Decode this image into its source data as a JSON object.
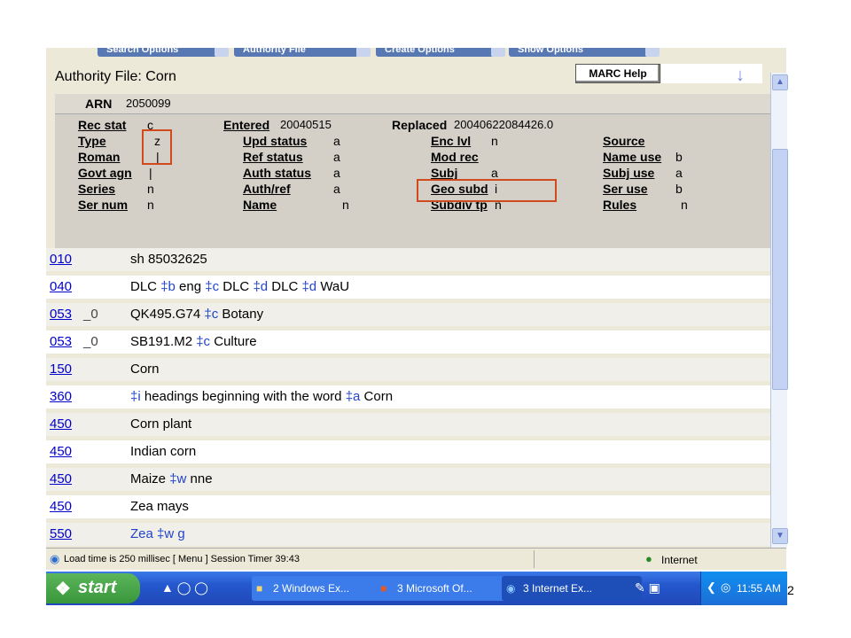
{
  "tabs": [
    "Search Options",
    "Authority File",
    "Create Options",
    "Show Options"
  ],
  "window": {
    "title": "Authority File: Corn",
    "marc_help": "MARC Help"
  },
  "fixed": {
    "arn_label": "ARN",
    "arn_value": "2050099",
    "rec_stat_label": "Rec stat",
    "rec_stat_value": "c",
    "entered_label": "Entered",
    "entered_value": "20040515",
    "replaced_label": "Replaced",
    "replaced_value": "20040622084426.0",
    "type_label": "Type",
    "type_value": "z",
    "upd_status_label": "Upd status",
    "upd_status_value": "a",
    "enc_lvl_label": "Enc lvl",
    "enc_lvl_value": "n",
    "source_label": "Source",
    "source_value": "",
    "roman_label": "Roman",
    "roman_value": "|",
    "ref_status_label": "Ref status",
    "ref_status_value": "a",
    "mod_rec_label": "Mod rec",
    "mod_rec_value": "",
    "name_use_label": "Name use",
    "name_use_value": "b",
    "govt_agn_label": "Govt agn",
    "govt_agn_value": "|",
    "auth_status_label": "Auth status",
    "auth_status_value": "a",
    "subj_label": "Subj",
    "subj_value": "a",
    "subj_use_label": "Subj use",
    "subj_use_value": "a",
    "series_label": "Series",
    "series_value": "n",
    "auth_ref_label": "Auth/ref",
    "auth_ref_value": "a",
    "geo_subd_label": "Geo subd",
    "geo_subd_value": "i",
    "ser_use_label": "Ser use",
    "ser_use_value": "b",
    "ser_num_label": "Ser num",
    "ser_num_value": "n",
    "name_label": "Name",
    "name_value": "n",
    "subdiv_tp_label": "Subdiv tp",
    "subdiv_tp_value": "n",
    "rules_label": "Rules",
    "rules_value": "n"
  },
  "rows": [
    {
      "tag": "010",
      "ind": "",
      "parts": [
        {
          "t": "sh 85032625"
        }
      ]
    },
    {
      "tag": "040",
      "ind": "",
      "parts": [
        {
          "t": "DLC "
        },
        {
          "t": "‡b",
          "sf": true
        },
        {
          "t": " eng "
        },
        {
          "t": "‡c",
          "sf": true
        },
        {
          "t": " DLC "
        },
        {
          "t": "‡d",
          "sf": true
        },
        {
          "t": " DLC "
        },
        {
          "t": "‡d",
          "sf": true
        },
        {
          "t": " WaU"
        }
      ]
    },
    {
      "tag": "053",
      "ind": "_0",
      "parts": [
        {
          "t": "QK495.G74 "
        },
        {
          "t": "‡c",
          "sf": true
        },
        {
          "t": " Botany"
        }
      ]
    },
    {
      "tag": "053",
      "ind": "_0",
      "parts": [
        {
          "t": "SB191.M2 "
        },
        {
          "t": "‡c",
          "sf": true
        },
        {
          "t": " Culture"
        }
      ]
    },
    {
      "tag": "150",
      "ind": "",
      "parts": [
        {
          "t": "Corn"
        }
      ]
    },
    {
      "tag": "360",
      "ind": "",
      "parts": [
        {
          "t": "‡i",
          "sf": true
        },
        {
          "t": " headings beginning with the word "
        },
        {
          "t": "‡a",
          "sf": true
        },
        {
          "t": " Corn"
        }
      ]
    },
    {
      "tag": "450",
      "ind": "",
      "parts": [
        {
          "t": "Corn plant"
        }
      ]
    },
    {
      "tag": "450",
      "ind": "",
      "parts": [
        {
          "t": "Indian corn"
        }
      ]
    },
    {
      "tag": "450",
      "ind": "",
      "parts": [
        {
          "t": "Maize "
        },
        {
          "t": "‡w",
          "sf": true
        },
        {
          "t": " nne"
        }
      ]
    },
    {
      "tag": "450",
      "ind": "",
      "parts": [
        {
          "t": "Zea mays"
        }
      ]
    },
    {
      "tag": "550",
      "ind": "",
      "parts": [
        {
          "t": "Zea ‡w g",
          "lnk": true
        }
      ]
    }
  ],
  "status": {
    "text": "Load time is 250 millisec [ Menu ]   Session Timer 39:43",
    "zone": "Internet"
  },
  "taskbar": {
    "start": "start",
    "tasks": [
      "2 Windows Ex...",
      "3 Microsoft Of...",
      "3 Internet Ex..."
    ],
    "clock": "11:55 AM",
    "page_number_fragment": "2"
  },
  "colors": {
    "highlight_box": "#d04a1e",
    "subfield": "#2244cc",
    "taskbar": "#2457cd"
  }
}
